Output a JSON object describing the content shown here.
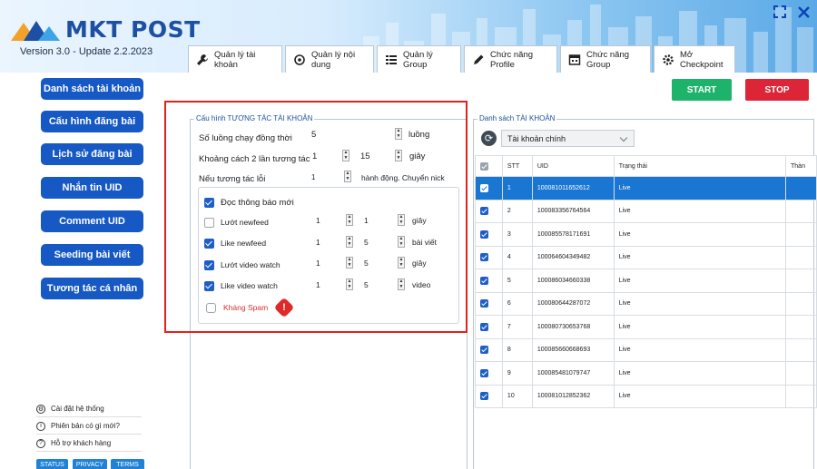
{
  "app": {
    "logo_text": "MKT POST",
    "version": "Version 3.0 - Update 2.2.2023"
  },
  "colors": {
    "primary": "#1658c4",
    "start": "#1db36b",
    "stop": "#dc2638",
    "highlight": "#e0231b",
    "selected_row": "#1976d2"
  },
  "tabs": [
    {
      "label": "Quản lý tài khoản",
      "icon": "wrench-icon"
    },
    {
      "label": "Quản lý nội dung",
      "icon": "refresh-search-icon"
    },
    {
      "label": "Quản lý Group",
      "icon": "list-icon"
    },
    {
      "label": "Chức năng Profile",
      "icon": "pencil-icon"
    },
    {
      "label": "Chức năng Group",
      "icon": "window-icon"
    },
    {
      "label": "Mở Checkpoint",
      "icon": "gear-icon"
    }
  ],
  "sidebar": {
    "items": [
      {
        "label": "Danh sách tài khoản"
      },
      {
        "label": "Cấu hình đăng bài"
      },
      {
        "label": "Lịch sử đăng bài"
      },
      {
        "label": "Nhắn tin UID"
      },
      {
        "label": "Comment UID"
      },
      {
        "label": "Seeding bài viết"
      },
      {
        "label": "Tương tác cá nhân"
      }
    ],
    "footer": [
      {
        "label": "Cài đặt hệ thống",
        "icon": "settings-icon"
      },
      {
        "label": "Phiên bản có gì mới?",
        "icon": "info-icon"
      },
      {
        "label": "Hỗ trợ khách hàng",
        "icon": "help-icon"
      }
    ],
    "pills": [
      "STATUS",
      "PRIVACY",
      "TERMS"
    ]
  },
  "actions": {
    "start": "START",
    "stop": "STOP"
  },
  "config": {
    "title": "Cấu hình TƯƠNG TÁC TÀI KHOẢN",
    "threads_label": "Số luồng chạy đồng thời",
    "threads_value": "5",
    "threads_unit": "luồng",
    "delay_label": "Khoảng cách 2 lần tương tác",
    "delay_min": "1",
    "delay_max": "15",
    "delay_unit": "giây",
    "error_label": "Nếu tương tác lỗi",
    "error_value": "1",
    "error_unit": "hành động. Chuyển nick",
    "read_notifications": "Đọc thông báo mới",
    "rows": [
      {
        "label": "Lướt newfeed",
        "min": "1",
        "max": "1",
        "unit": "giây",
        "checked": false
      },
      {
        "label": "Like newfeed",
        "min": "1",
        "max": "5",
        "unit": "bài viết",
        "checked": true
      },
      {
        "label": "Lướt video watch",
        "min": "1",
        "max": "5",
        "unit": "giây",
        "checked": true
      },
      {
        "label": "Like video watch",
        "min": "1",
        "max": "5",
        "unit": "video",
        "checked": true
      }
    ],
    "anti_spam": "Kháng Spam"
  },
  "accounts": {
    "title": "Danh sách TÀI KHOẢN",
    "combo_value": "Tài khoản chính",
    "headers": [
      "STT",
      "UID",
      "Trạng thái",
      "Thàn"
    ],
    "rows": [
      {
        "stt": "1",
        "uid": "100081011652612",
        "status": "Live"
      },
      {
        "stt": "2",
        "uid": "100083356764564",
        "status": "Live"
      },
      {
        "stt": "3",
        "uid": "100085578171691",
        "status": "Live"
      },
      {
        "stt": "4",
        "uid": "100064604349482",
        "status": "Live"
      },
      {
        "stt": "5",
        "uid": "100086034660338",
        "status": "Live"
      },
      {
        "stt": "6",
        "uid": "100080644287072",
        "status": "Live"
      },
      {
        "stt": "7",
        "uid": "100080730653768",
        "status": "Live"
      },
      {
        "stt": "8",
        "uid": "100085660668693",
        "status": "Live"
      },
      {
        "stt": "9",
        "uid": "100085481079747",
        "status": "Live"
      },
      {
        "stt": "10",
        "uid": "100081012852362",
        "status": "Live"
      }
    ]
  }
}
